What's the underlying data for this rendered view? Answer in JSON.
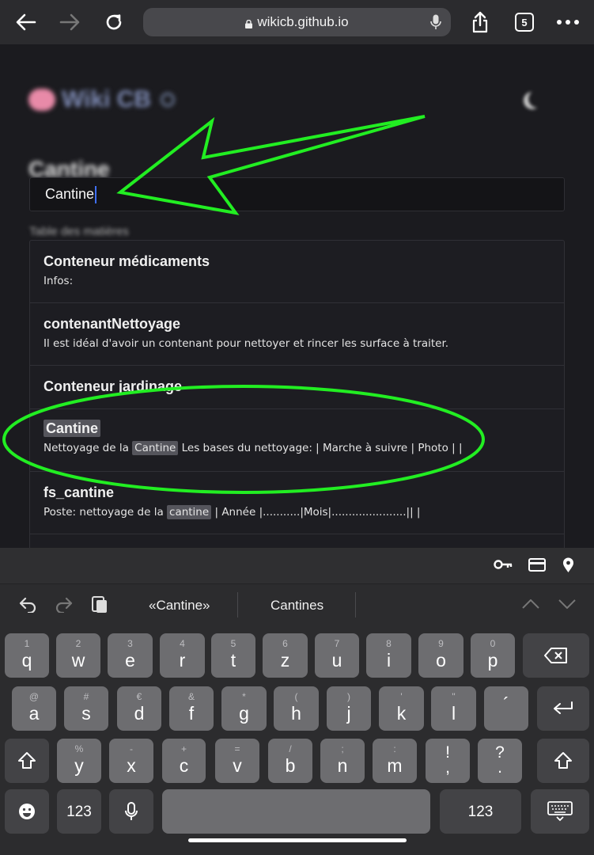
{
  "browser": {
    "url": "wikicb.github.io",
    "tabs_count": "5"
  },
  "page": {
    "site_title": "Wiki CB",
    "page_title": "Cantine",
    "search_value": "Cantine",
    "toc_label": "Table des matières",
    "results": [
      {
        "title": "Conteneur médicaments",
        "snippet_parts": [
          "Infos:"
        ]
      },
      {
        "title": "contenantNettoyage",
        "snippet_parts": [
          "Il est idéal d'avoir un contenant pour nettoyer et rincer les surface à traiter."
        ]
      },
      {
        "title": "Conteneur jardinage",
        "snippet_parts": []
      },
      {
        "title": "Cantine",
        "snippet_before": "Nettoyage de la ",
        "snippet_hl": "Cantine",
        "snippet_after": " Les bases du nettoyage: | Marche à suivre | Photo | |"
      },
      {
        "title": "fs_cantine",
        "snippet_before": "Poste: nettoyage de la ",
        "snippet_hl": "cantine",
        "snippet_after": " | Année |...........|Mois|......................|| |"
      }
    ]
  },
  "keyboard": {
    "suggestions": [
      "«Cantine»",
      "Cantines"
    ],
    "row1": [
      [
        "1",
        "q"
      ],
      [
        "2",
        "w"
      ],
      [
        "3",
        "e"
      ],
      [
        "4",
        "r"
      ],
      [
        "5",
        "t"
      ],
      [
        "6",
        "z"
      ],
      [
        "7",
        "u"
      ],
      [
        "8",
        "i"
      ],
      [
        "9",
        "o"
      ],
      [
        "0",
        "p"
      ]
    ],
    "row2": [
      [
        "@",
        "a"
      ],
      [
        "#",
        "s"
      ],
      [
        "€",
        "d"
      ],
      [
        "&",
        "f"
      ],
      [
        "*",
        "g"
      ],
      [
        "(",
        "h"
      ],
      [
        ")",
        "j"
      ],
      [
        "'",
        "k"
      ],
      [
        "\"",
        "l"
      ],
      [
        "",
        "´"
      ]
    ],
    "row3": [
      [
        "%",
        "y"
      ],
      [
        "-",
        "x"
      ],
      [
        "+",
        "c"
      ],
      [
        "=",
        "v"
      ],
      [
        "/",
        "b"
      ],
      [
        ";",
        "n"
      ],
      [
        ":",
        "m"
      ],
      [
        "",
        "!\n,"
      ],
      [
        "",
        "?\n."
      ]
    ],
    "num_label_left": "123",
    "num_label_right": "123"
  },
  "colors": {
    "annotation": "#22ee22",
    "caret": "#3f6ff2"
  }
}
